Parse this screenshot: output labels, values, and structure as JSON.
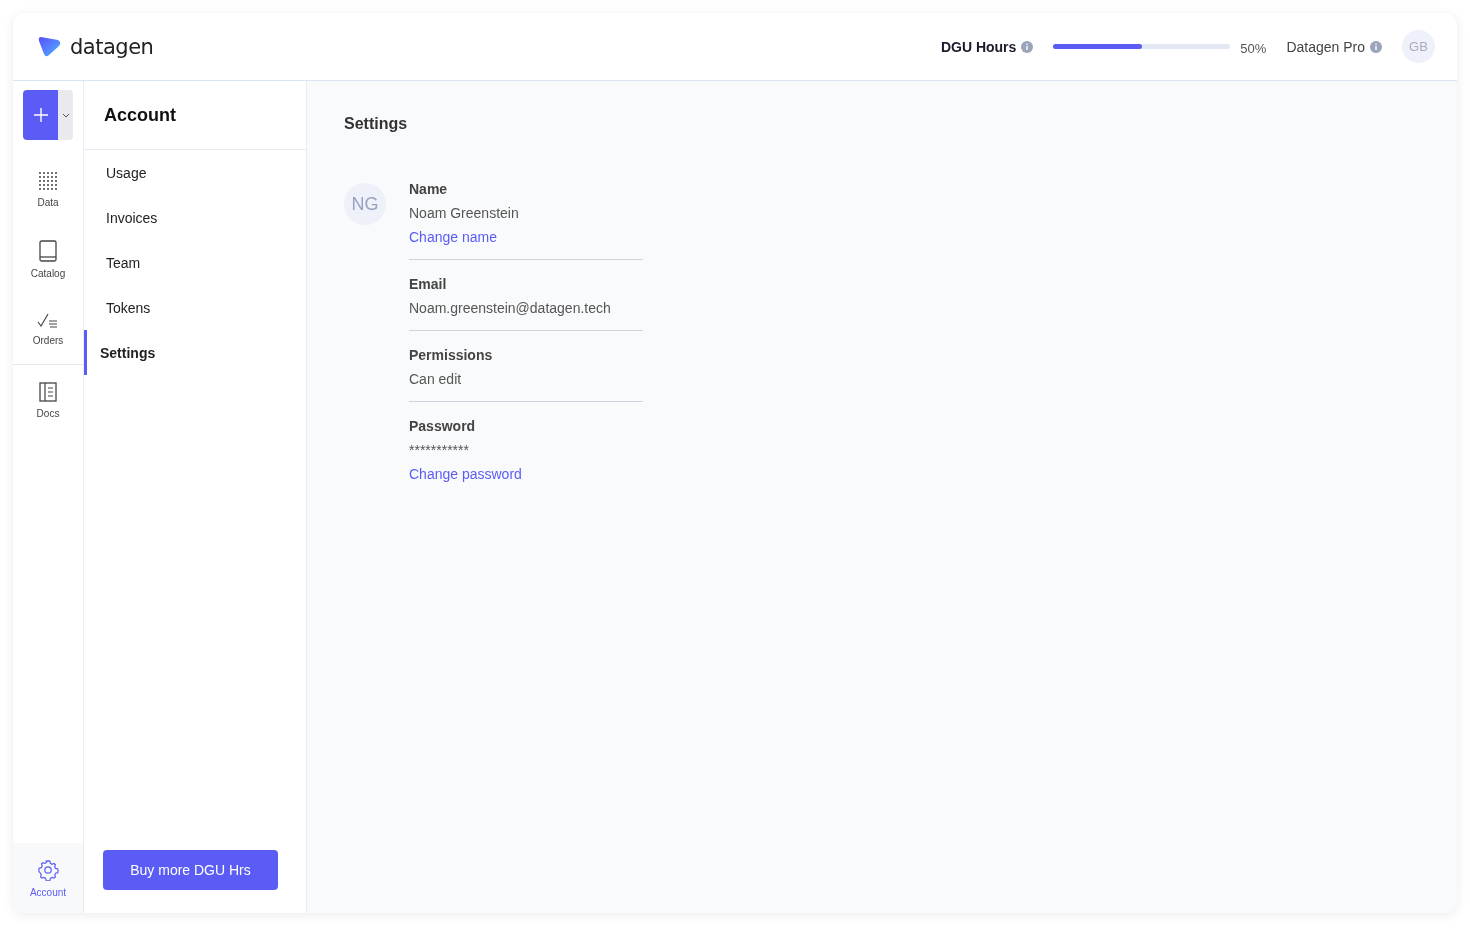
{
  "brand": "datagen",
  "header": {
    "hours_label": "DGU Hours",
    "level": 0.5,
    "percent": "50%",
    "plan": "Datagen Pro",
    "avatar": "GB"
  },
  "rail": [
    {
      "kind": "data",
      "label": "Data",
      "selected": false
    },
    {
      "kind": "catalog",
      "label": "Catalog",
      "selected": false
    },
    {
      "kind": "orders",
      "label": "Orders",
      "selected": false
    },
    {
      "kind": "docs",
      "label": "Docs",
      "selected": false
    }
  ],
  "rail_bottom": {
    "label": "Account",
    "selected": true
  },
  "subnav": {
    "title": "Account",
    "items": [
      {
        "label": "Usage",
        "selected": false
      },
      {
        "label": "Invoices",
        "selected": false
      },
      {
        "label": "Team",
        "selected": false
      },
      {
        "label": "Tokens",
        "selected": false
      },
      {
        "label": "Settings",
        "selected": true
      }
    ],
    "button": "Buy more DGU Hrs"
  },
  "main": {
    "title": "Settings",
    "avatar": "NG",
    "fields": [
      {
        "label": "Name",
        "value": "Noam Greenstein",
        "link": "Change name"
      },
      {
        "label": "Email",
        "value": "Noam.greenstein@datagen.tech"
      },
      {
        "label": "Permissions",
        "value": "Can edit"
      },
      {
        "label": "Password",
        "value": "***********",
        "link": "Change password"
      }
    ]
  }
}
